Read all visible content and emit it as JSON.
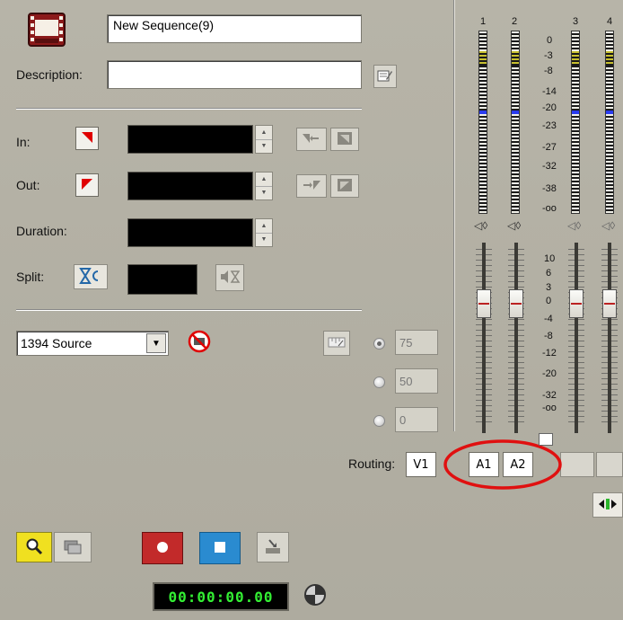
{
  "sequence": {
    "name_value": "New Sequence(9)",
    "description_label": "Description:",
    "description_value": ""
  },
  "timecode": {
    "in_label": "In:",
    "out_label": "Out:",
    "duration_label": "Duration:",
    "split_label": "Split:"
  },
  "source": {
    "device_selected": "1394 Source",
    "percent_options": [
      "75",
      "50",
      "0"
    ]
  },
  "routing": {
    "label": "Routing:",
    "video_track": "V1",
    "audio_tracks": [
      "A1",
      "A2"
    ]
  },
  "transport": {
    "timecode_display": "00:00:00.00"
  },
  "mixer": {
    "channel_numbers": [
      "1",
      "2",
      "3",
      "4"
    ],
    "meter_scale": [
      "0",
      "-3",
      "-8",
      "-14",
      "-20",
      "-23",
      "-27",
      "-32",
      "-38",
      "-oo"
    ],
    "fader_scale": [
      "10",
      "6",
      "3",
      "0",
      "-4",
      "-8",
      "-12",
      "-20",
      "-32",
      "-oo"
    ]
  },
  "colors": {
    "accent_red": "#e00000",
    "record_red": "#c22a2a",
    "stop_blue": "#2a8bd0",
    "timecode_green": "#33ee33",
    "highlight_yellow": "#f0e020",
    "annotation_red": "#e01010"
  }
}
